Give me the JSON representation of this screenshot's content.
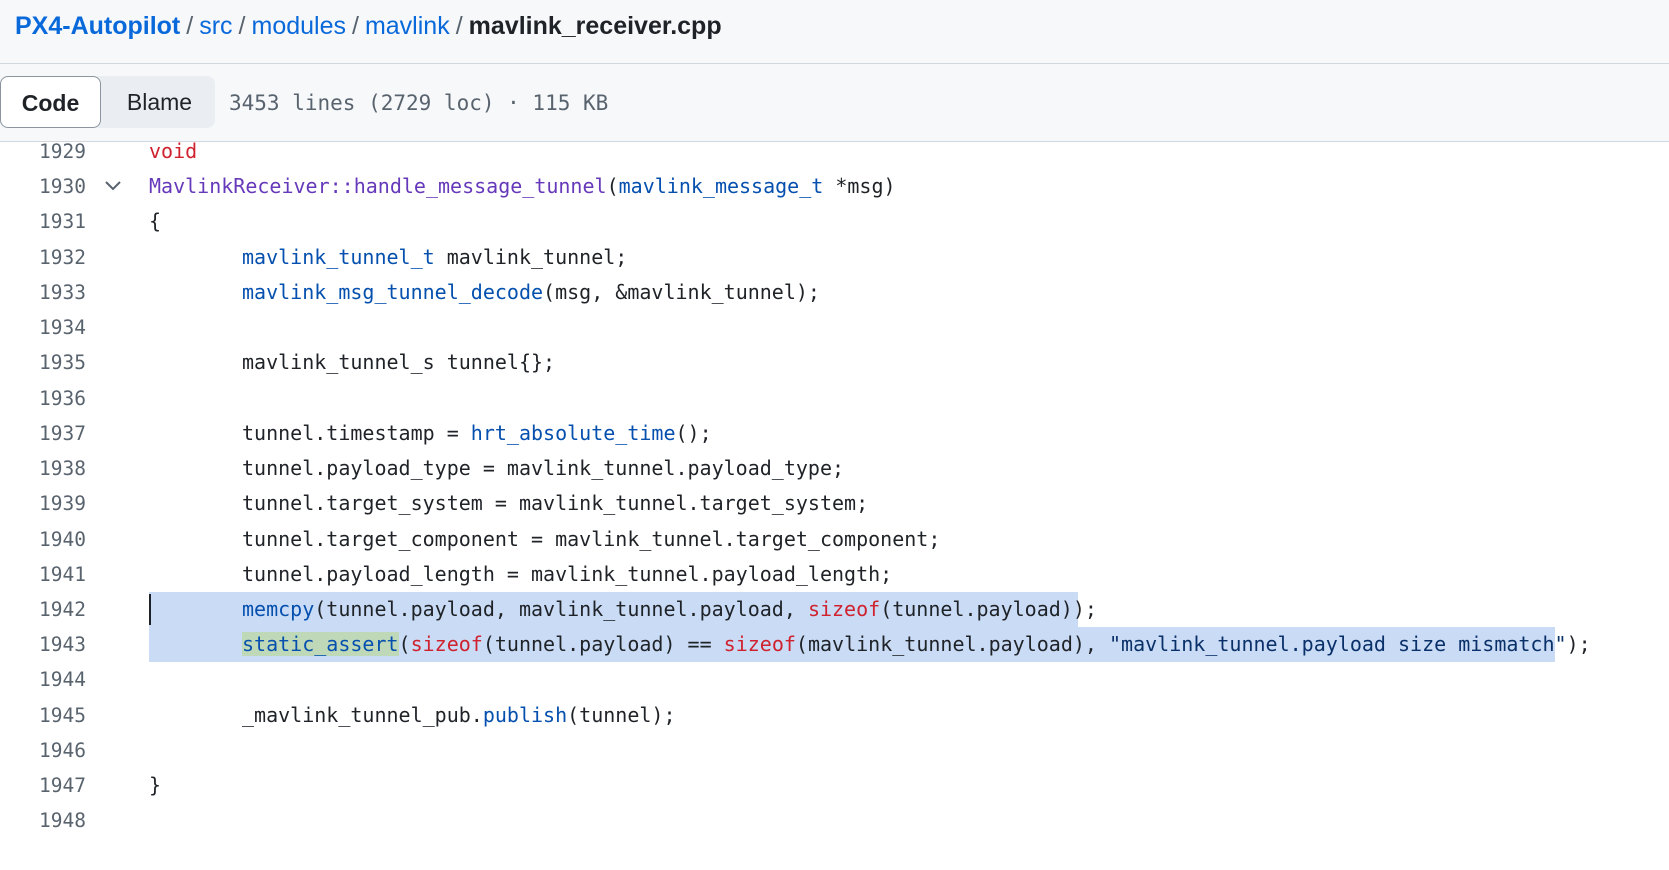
{
  "breadcrumb": {
    "repo": "PX4-Autopilot",
    "sep": "/",
    "path": [
      "src",
      "modules",
      "mavlink"
    ],
    "current": "mavlink_receiver.cpp"
  },
  "toolbar": {
    "code_label": "Code",
    "blame_label": "Blame",
    "file_info": "3453 lines (2729 loc) · 115 KB"
  },
  "code": {
    "line_numbers": [
      "1929",
      "1930",
      "1931",
      "1932",
      "1933",
      "1934",
      "1935",
      "1936",
      "1937",
      "1938",
      "1939",
      "1940",
      "1941",
      "1942",
      "1943",
      "1944",
      "1945",
      "1946",
      "1947",
      "1948"
    ],
    "l1929": {
      "kw": "void"
    },
    "l1930": {
      "cls": "MavlinkReceiver::handle_message_tunnel",
      "open": "(",
      "type": "mavlink_message_t",
      "rest": " *msg)"
    },
    "l1931": {
      "text": "{"
    },
    "l1932": {
      "type": "mavlink_tunnel_t",
      "rest": " mavlink_tunnel;"
    },
    "l1933": {
      "fn": "mavlink_msg_tunnel_decode",
      "rest": "(msg, &mavlink_tunnel);"
    },
    "l1935": {
      "text": "mavlink_tunnel_s tunnel{};"
    },
    "l1937": {
      "pre": "tunnel.timestamp = ",
      "fn": "hrt_absolute_time",
      "rest": "();"
    },
    "l1938": {
      "text": "tunnel.payload_type = mavlink_tunnel.payload_type;"
    },
    "l1939": {
      "text": "tunnel.target_system = mavlink_tunnel.target_system;"
    },
    "l1940": {
      "text": "tunnel.target_component = mavlink_tunnel.target_component;"
    },
    "l1941": {
      "text": "tunnel.payload_length = mavlink_tunnel.payload_length;"
    },
    "l1942": {
      "fn": "memcpy",
      "mid": "(tunnel.payload, mavlink_tunnel.payload, ",
      "kw": "sizeof",
      "rest": "(tunnel.payload));"
    },
    "l1943": {
      "fn": "static_assert",
      "open": "(",
      "kw1": "sizeof",
      "mid": "(tunnel.payload) == ",
      "kw2": "sizeof",
      "mid2": "(mavlink_tunnel.payload), ",
      "str": "\"mavlink_tunnel.payload size mismatch\"",
      "rest": ");"
    },
    "l1945": {
      "pre": "_mavlink_tunnel_pub.",
      "fn": "publish",
      "rest": "(tunnel);"
    },
    "l1947": {
      "text": "}"
    }
  },
  "colors": {
    "keyword": "#cf222e",
    "function": "#6639ba",
    "type": "#0550ae",
    "selection": "#c9dbf5",
    "link": "#0969da"
  }
}
